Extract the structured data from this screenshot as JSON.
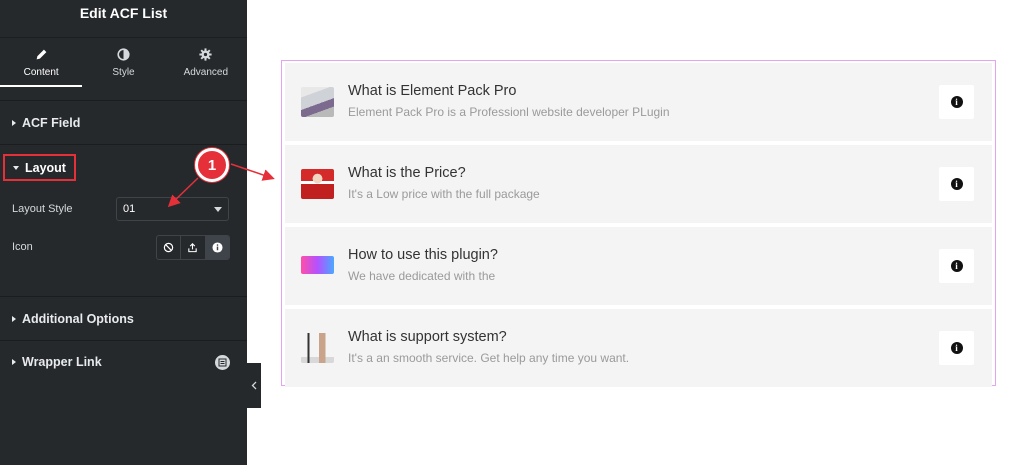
{
  "panel": {
    "title": "Edit ACF List",
    "tabs": [
      {
        "label": "Content",
        "icon": "pencil-icon"
      },
      {
        "label": "Style",
        "icon": "half-circle-icon"
      },
      {
        "label": "Advanced",
        "icon": "gear-icon"
      }
    ],
    "sections": {
      "acf_field": "ACF Field",
      "layout": "Layout",
      "additional_options": "Additional Options",
      "wrapper_link": "Wrapper Link"
    },
    "controls": {
      "layout_style_label": "Layout Style",
      "layout_style_value": "01",
      "icon_label": "Icon",
      "icon_options": [
        "none-icon",
        "upload-icon",
        "info-icon"
      ]
    },
    "accent_color": "#e5303a"
  },
  "annotation": {
    "badge": "1"
  },
  "list": {
    "border_color": "#e3a5ee",
    "items": [
      {
        "title": "What is Element Pack Pro",
        "desc": "Element Pack Pro is a Professionl website developer PLugin",
        "thumb": "laptop-image"
      },
      {
        "title": "What is the Price?",
        "desc": "It's a Low price with the full package",
        "thumb": "santa-image"
      },
      {
        "title": "How to use this plugin?",
        "desc": "We have dedicated with the",
        "thumb": "gradient-image"
      },
      {
        "title": "What is support system?",
        "desc": "It's a an smooth service. Get help any time you want.",
        "thumb": "desk-image"
      }
    ],
    "info_glyph": "i"
  }
}
